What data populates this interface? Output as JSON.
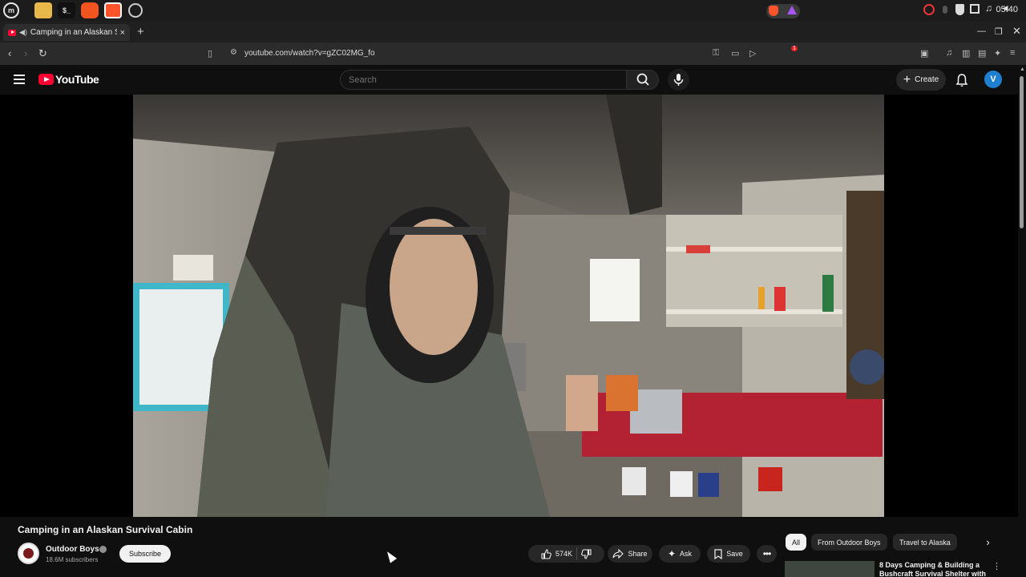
{
  "os": {
    "clock": "05:40",
    "apps": [
      "mint-menu",
      "files",
      "terminal",
      "firefox",
      "brave",
      "app"
    ]
  },
  "browser": {
    "tab_title": "Camping in an Alaskan Survival Cabin",
    "tab_close": "×",
    "new_tab": "+",
    "url": "youtube.com/watch?v=gZC02MG_fo",
    "shields_count": "1"
  },
  "youtube": {
    "logo_text": "YouTube",
    "search_placeholder": "Search",
    "create_label": "Create",
    "avatar_letter": "V"
  },
  "video": {
    "title": "Camping in an Alaskan Survival Cabin",
    "channel": "Outdoor Boys",
    "subscribers": "18.6M subscribers",
    "subscribe_label": "Subscribe",
    "likes": "574K",
    "share_label": "Share",
    "ask_label": "Ask",
    "save_label": "Save"
  },
  "chips": [
    "All",
    "From Outdoor Boys",
    "Travel to Alaska"
  ],
  "recommendation": {
    "title": "8 Days Camping & Building a Bushcraft Survival Shelter with"
  },
  "colors": {
    "background": "#0f0f0f",
    "accent_red": "#ff0033",
    "avatar_blue": "#1e7fd0"
  }
}
